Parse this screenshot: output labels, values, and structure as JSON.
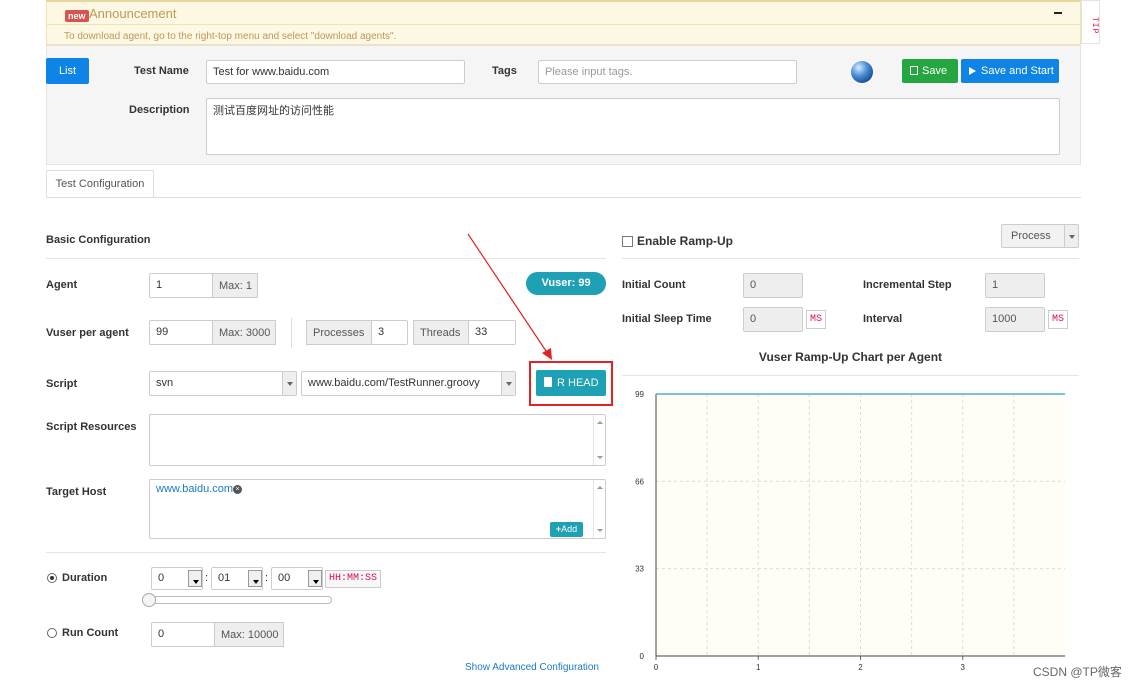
{
  "announcement": {
    "badge": "new",
    "title": "Announcement",
    "message": "To download agent, go to the right-top menu and select \"download agents\".",
    "tip": "TIP"
  },
  "header": {
    "list_button": "List",
    "test_name_label": "Test Name",
    "test_name_value": "Test for www.baidu.com",
    "tags_label": "Tags",
    "tags_placeholder": "Please input tags.",
    "save_button": "Save",
    "save_and_start_button": "Save and Start",
    "description_label": "Description",
    "description_value": "测试百度网址的访问性能"
  },
  "tabs": [
    {
      "label": "Test Configuration"
    }
  ],
  "basic": {
    "title": "Basic Configuration",
    "agent_label": "Agent",
    "agent_value": "1",
    "agent_max": "Max: 1",
    "vuser_badge": "Vuser: 99",
    "vuser_per_agent_label": "Vuser per agent",
    "vuser_per_agent_value": "99",
    "vuser_max": "Max: 3000",
    "processes_label": "Processes",
    "processes_value": "3",
    "threads_label": "Threads",
    "threads_value": "33",
    "script_label": "Script",
    "script_repo": "svn",
    "script_file": "www.baidu.com/TestRunner.groovy",
    "rhead_button": "R HEAD",
    "script_resources_label": "Script Resources",
    "target_host_label": "Target Host",
    "target_host_value": "www.baidu.com",
    "add_button": "Add",
    "duration_label": "Duration",
    "duration_hours": "0",
    "duration_minutes": "01",
    "duration_seconds": "00",
    "duration_format": "HH:MM:SS",
    "run_count_label": "Run Count",
    "run_count_value": "0",
    "run_count_max": "Max: 10000",
    "advanced_link": "Show Advanced Configuration"
  },
  "rampup": {
    "enable_label": "Enable Ramp-Up",
    "mode": "Process",
    "initial_count_label": "Initial Count",
    "initial_count_value": "0",
    "incremental_step_label": "Incremental Step",
    "incremental_step_value": "1",
    "initial_sleep_label": "Initial Sleep Time",
    "initial_sleep_value": "0",
    "interval_label": "Interval",
    "interval_value": "1000",
    "ms_unit": "MS"
  },
  "chart_data": {
    "type": "line",
    "title": "Vuser Ramp-Up Chart per Agent",
    "xlabel": "",
    "ylabel": "",
    "x_ticks": [
      "0",
      "1",
      "2",
      "3"
    ],
    "y_ticks": [
      "0",
      "33",
      "66",
      "99"
    ],
    "xlim": [
      0,
      4
    ],
    "ylim": [
      0,
      99
    ],
    "series": [
      {
        "x": [
          0,
          4
        ],
        "values": [
          99,
          99
        ]
      }
    ],
    "line_color": "#4bb1cf",
    "background": "#fffdf6"
  },
  "watermark": "CSDN @TP微客"
}
